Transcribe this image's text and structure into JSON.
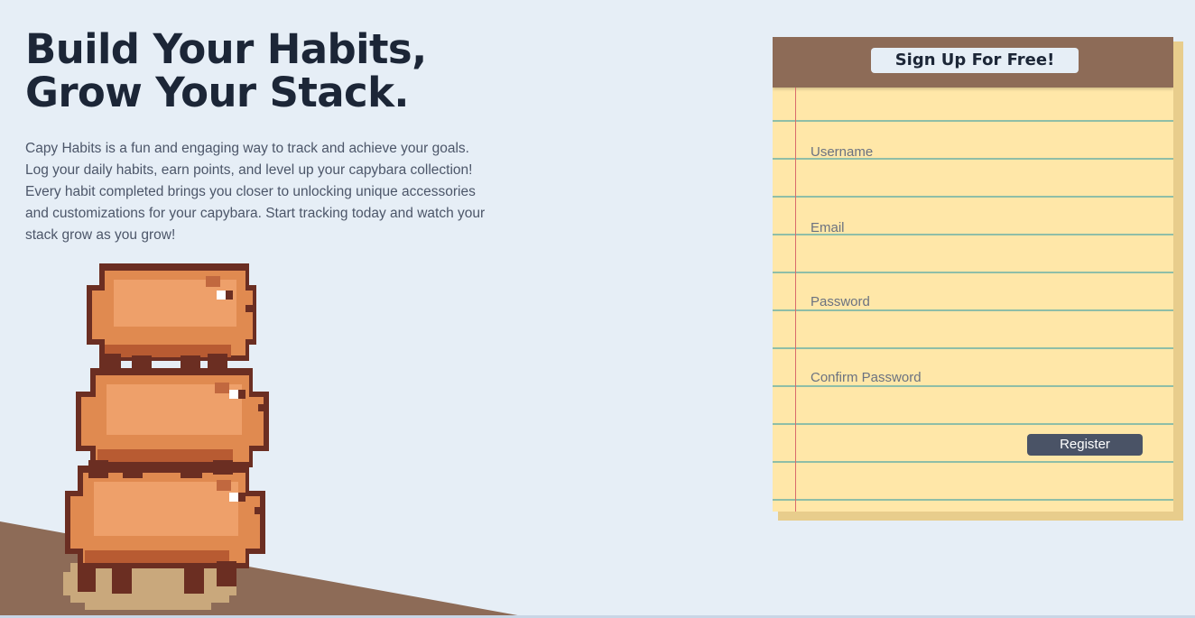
{
  "hero": {
    "title_line1": "Build Your Habits,",
    "title_line2": "Grow Your Stack.",
    "description": "Capy Habits is a fun and engaging way to track and achieve your goals. Log your daily habits, earn points, and level up your capybara collection! Every habit completed brings you closer to unlocking unique accessories and customizations for your capybara. Start tracking today and watch your stack grow as you grow!"
  },
  "signup": {
    "title": "Sign Up For Free!",
    "username_placeholder": "Username",
    "email_placeholder": "Email",
    "password_placeholder": "Password",
    "confirm_password_placeholder": "Confirm Password",
    "register_label": "Register"
  },
  "colors": {
    "background": "#e6eef6",
    "hill": "#8d6b57",
    "notepad_paper": "#ffe7a8",
    "notepad_header": "#8d6b57",
    "rule_line": "#8fbea7",
    "margin_line": "#d96b6b",
    "register_button": "#4a5366",
    "heading_text": "#1c2637",
    "capybara_body": "#e08a50",
    "capybara_outline": "#6b2e22"
  },
  "illustration": {
    "capybara_count": 3
  }
}
